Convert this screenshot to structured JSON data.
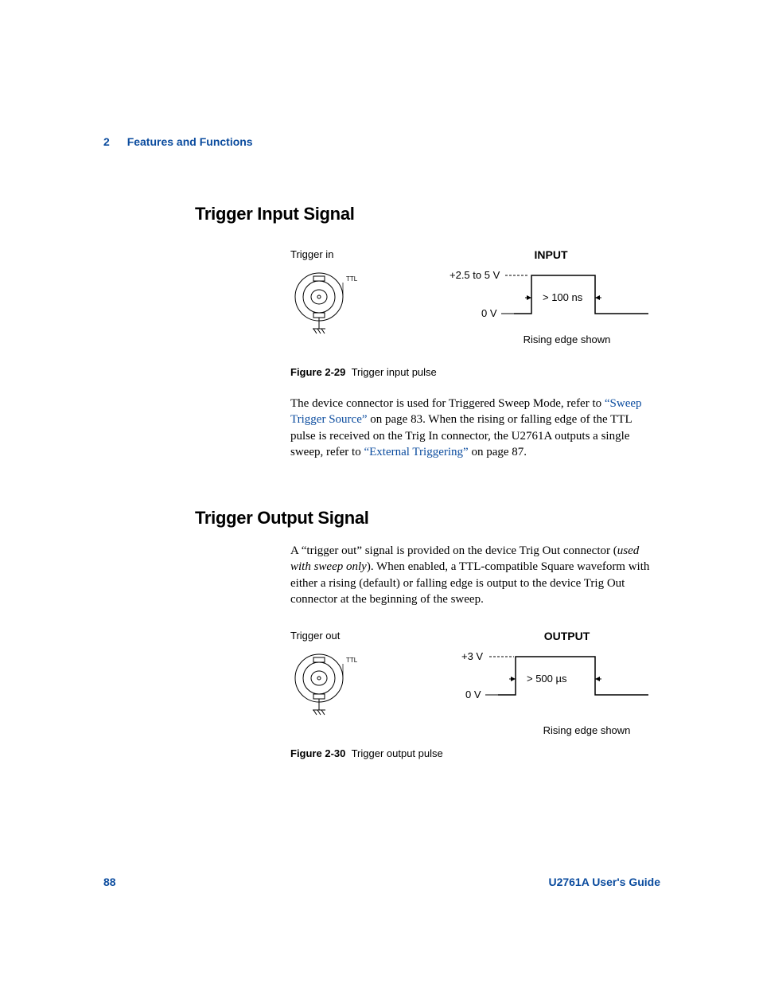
{
  "header": {
    "chapter_number": "2",
    "chapter_title": "Features and Functions"
  },
  "section1": {
    "title": "Trigger Input Signal",
    "fig_left_label": "Trigger in",
    "bnc_label": "TTL",
    "diagram": {
      "title": "INPUT",
      "high_label": "+2.5 to 5 V",
      "low_label": "0 V",
      "width_label": "> 100 ns",
      "edge_caption": "Rising edge shown"
    },
    "figure_caption_num": "Figure 2-29",
    "figure_caption_text": "Trigger input pulse",
    "para_pre": "The device connector is used for Triggered Sweep Mode, refer to ",
    "link1": "“Sweep Trigger Source”",
    "para_mid": " on page 83. When the rising or falling edge of the TTL pulse is received on the Trig In connector, the U2761A outputs a single sweep, refer to ",
    "link2": "“External Triggering”",
    "para_post": " on page 87."
  },
  "section2": {
    "title": "Trigger Output Signal",
    "para_pre": "A “trigger out” signal is provided on the device Trig Out connector (",
    "para_italic": "used with sweep only",
    "para_post": "). When enabled, a TTL-compatible Square waveform with either a rising (default) or falling edge is output to the device Trig Out connector at the beginning of the sweep.",
    "fig_left_label": "Trigger out",
    "bnc_label": "TTL",
    "diagram": {
      "title": "OUTPUT",
      "high_label": "+3 V",
      "low_label": "0 V",
      "width_label": "> 500 µs",
      "edge_caption": "Rising edge shown"
    },
    "figure_caption_num": "Figure 2-30",
    "figure_caption_text": "Trigger output pulse"
  },
  "footer": {
    "page_number": "88",
    "guide_title": "U2761A User's Guide"
  }
}
